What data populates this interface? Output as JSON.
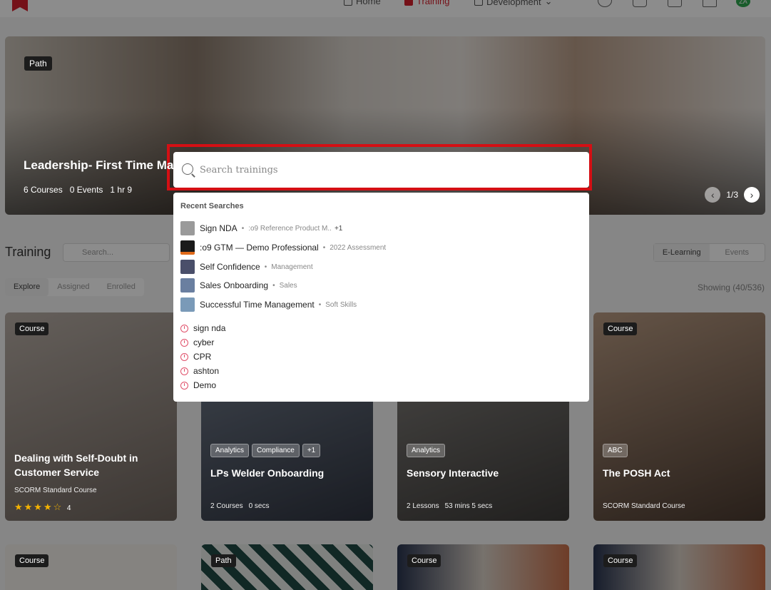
{
  "nav": {
    "home": "Home",
    "training": "Training",
    "development": "Development",
    "avatar_initials": "ZA"
  },
  "hero": {
    "tag": "Path",
    "title": "Leadership- First Time Ma",
    "courses": "6 Courses",
    "events": "0 Events",
    "duration": "1 hr 9",
    "pagination": "1/3"
  },
  "training": {
    "title": "Training",
    "search_placeholder": "Search...",
    "segments": [
      "E-Learning",
      "Events"
    ],
    "tabs": [
      "Explore",
      "Assigned",
      "Enrolled"
    ],
    "showing": "Showing (40/536)"
  },
  "cards": [
    {
      "tag": "Course",
      "title": "Dealing with Self-Doubt in Customer Service",
      "type": "SCORM Standard Course",
      "rating": "4"
    },
    {
      "chips": [
        "Analytics",
        "Compliance",
        "+1"
      ],
      "title": "LPs Welder Onboarding",
      "courses": "2 Courses",
      "duration": "0 secs"
    },
    {
      "chips": [
        "Analytics"
      ],
      "title": "Sensory Interactive",
      "lessons": "2 Lessons",
      "duration": "53 mins 5 secs"
    },
    {
      "tag": "Course",
      "chips": [
        "ABC"
      ],
      "title": "The POSH Act",
      "type": "SCORM Standard Course"
    }
  ],
  "bottom_cards": [
    "Course",
    "Path",
    "Course",
    "Course"
  ],
  "search": {
    "placeholder": "Search trainings",
    "recent_heading": "Recent Searches",
    "recent": [
      {
        "title": "Sign NDA",
        "category": ":o9 Reference Product M..",
        "extra": "+1",
        "thumb_color": "#9a9a9a"
      },
      {
        "title": ":o9 GTM — Demo Professional",
        "category": "2022 Assessment",
        "thumb_color": "#1a1a1a"
      },
      {
        "title": "Self Confidence",
        "category": "Management",
        "thumb_color": "#4a4f6a"
      },
      {
        "title": "Sales Onboarding",
        "category": "Sales",
        "thumb_color": "#6a7fa0"
      },
      {
        "title": "Successful Time Management",
        "category": "Soft Skills",
        "thumb_color": "#7a9ab8"
      }
    ],
    "history": [
      "sign nda",
      "cyber",
      "CPR",
      "ashton",
      "Demo"
    ],
    "accent_color": "#e0506a",
    "highlight_color": "#d40f14"
  }
}
